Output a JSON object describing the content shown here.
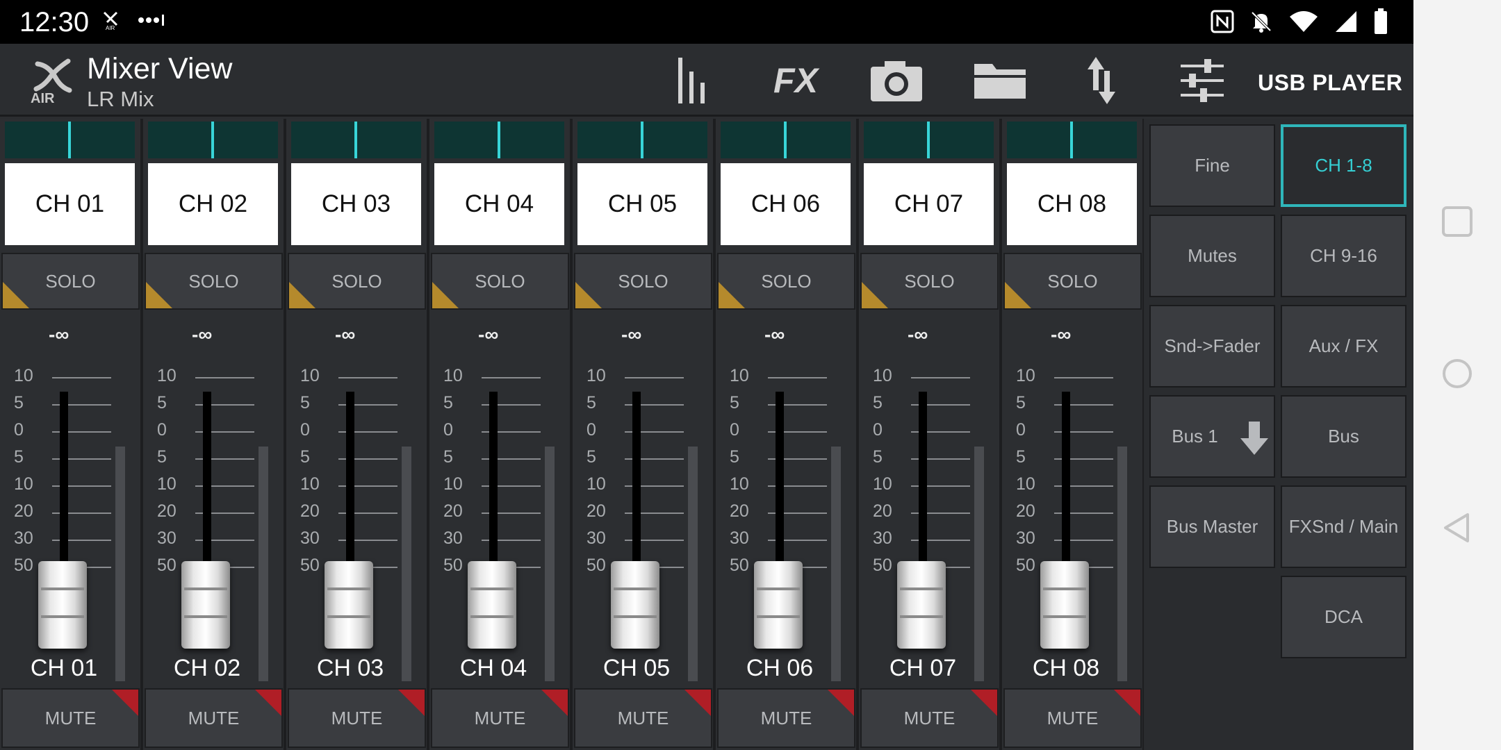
{
  "status": {
    "time": "12:30",
    "left_icons": [
      "x-air-status-icon",
      "signal-dots-icon"
    ],
    "right_icons": [
      "nfc-icon",
      "bell-off-icon",
      "wifi-icon",
      "cell-signal-icon",
      "battery-icon"
    ]
  },
  "app": {
    "title": "Mixer View",
    "subtitle": "LR Mix",
    "toolbar": [
      "meters-icon",
      "fx-label",
      "snapshot-camera-icon",
      "folder-icon",
      "sync-arrows-icon",
      "eq-sliders-icon"
    ],
    "fx_label": "FX",
    "usb_player_label": "USB PLAYER"
  },
  "mixer": {
    "scale_labels": [
      "10",
      "5",
      "0",
      "5",
      "10",
      "20",
      "30",
      "50"
    ],
    "channels": [
      {
        "name": "CH 01",
        "solo": "SOLO",
        "mute": "MUTE",
        "gain": "-∞"
      },
      {
        "name": "CH 02",
        "solo": "SOLO",
        "mute": "MUTE",
        "gain": "-∞"
      },
      {
        "name": "CH 03",
        "solo": "SOLO",
        "mute": "MUTE",
        "gain": "-∞"
      },
      {
        "name": "CH 04",
        "solo": "SOLO",
        "mute": "MUTE",
        "gain": "-∞"
      },
      {
        "name": "CH 05",
        "solo": "SOLO",
        "mute": "MUTE",
        "gain": "-∞"
      },
      {
        "name": "CH 06",
        "solo": "SOLO",
        "mute": "MUTE",
        "gain": "-∞"
      },
      {
        "name": "CH 07",
        "solo": "SOLO",
        "mute": "MUTE",
        "gain": "-∞"
      },
      {
        "name": "CH 08",
        "solo": "SOLO",
        "mute": "MUTE",
        "gain": "-∞"
      }
    ]
  },
  "side_panel": {
    "buttons": [
      {
        "label": "Fine"
      },
      {
        "label": "CH 1-8",
        "active": true
      },
      {
        "label": "Mutes"
      },
      {
        "label": "CH 9-16"
      },
      {
        "label": "Snd->Fader"
      },
      {
        "label": "Aux / FX"
      },
      {
        "label": "Bus 1"
      },
      {
        "label": "Bus"
      },
      {
        "label": "Bus Master"
      },
      {
        "label": "FXSnd / Main"
      },
      {
        "label": "DCA"
      }
    ]
  },
  "colors": {
    "accent": "#35cfd3",
    "solo_corner": "#b58a2c",
    "mute_corner": "#b01e26"
  }
}
